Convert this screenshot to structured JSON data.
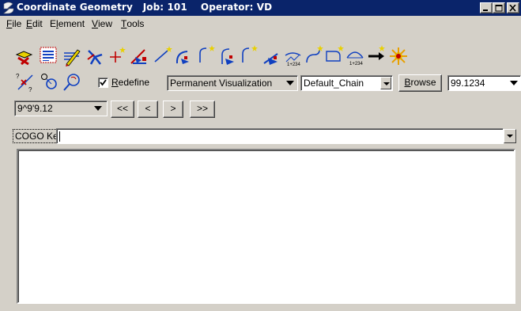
{
  "window": {
    "title": "Coordinate Geometry   Job: 101    Operator: VD"
  },
  "menu": {
    "file": {
      "mnemonic": "F",
      "rest": "ile"
    },
    "edit": {
      "mnemonic": "E",
      "rest": "dit"
    },
    "element": {
      "first": "E",
      "mnemonic": "l",
      "rest": "ement"
    },
    "view": {
      "mnemonic": "V",
      "rest": "iew"
    },
    "tools": {
      "mnemonic": "T",
      "rest": "ools"
    }
  },
  "toolbar": {
    "tool_icons": [
      "locate-point-icon",
      "list-icon",
      "edit-pencil-icon",
      "point-star-icon",
      "store-point-icon",
      "bearing-distance-icon",
      "line-icon",
      "curve-icon",
      "curve-arrow-icon",
      "spiral-icon",
      "spiral-arrow-icon",
      "station-offset-icon",
      "offset-line-icon",
      "parcel-icon",
      "station-curve-icon",
      "arrow-icon",
      "sun-icon"
    ],
    "row2_icons": [
      "no-point-icon",
      "radius-circle-icon",
      "search-probe-icon"
    ]
  },
  "redefine": {
    "checked": true,
    "mnemonic": "R",
    "rest": "edefine"
  },
  "visualization": {
    "selected": "Permanent Visualization"
  },
  "chain": {
    "value": "Default_Chain"
  },
  "browse": {
    "mnemonic": "B",
    "rest": "rowse"
  },
  "value_combo": {
    "value": "99.1234"
  },
  "angle_combo": {
    "value": "9^9'9.12"
  },
  "nav": {
    "first": "<<",
    "prev": "<",
    "next": ">",
    "last": ">>"
  },
  "keyin": {
    "label": "COGO Key-in:",
    "value": ""
  },
  "colors": {
    "title_bar": "#0a246a",
    "face": "#d4d0c8",
    "icon_red": "#c00000",
    "icon_yellow": "#e8d000",
    "icon_blue": "#1040c0"
  }
}
